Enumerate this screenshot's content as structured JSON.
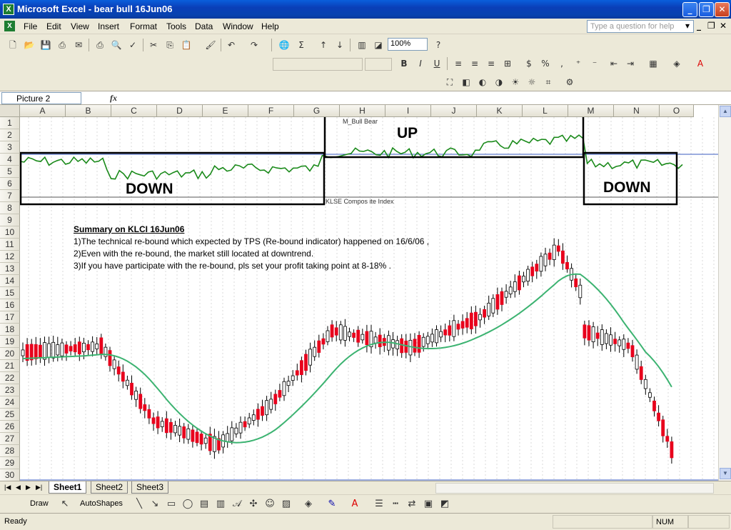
{
  "window": {
    "title": "Microsoft Excel - bear bull 16Jun06",
    "app_icon_glyph": "X"
  },
  "menu": {
    "items": [
      "File",
      "Edit",
      "View",
      "Insert",
      "Format",
      "Tools",
      "Data",
      "Window",
      "Help"
    ],
    "help_placeholder": "Type a question for help"
  },
  "toolbar": {
    "zoom": "100%"
  },
  "formula_bar": {
    "name_box": "Picture 2",
    "fx": "fx"
  },
  "columns": [
    "A",
    "B",
    "C",
    "D",
    "E",
    "F",
    "G",
    "H",
    "I",
    "J",
    "K",
    "L",
    "M",
    "N",
    "O"
  ],
  "rows": [
    "1",
    "2",
    "3",
    "4",
    "5",
    "6",
    "7",
    "8",
    "9",
    "10",
    "11",
    "12",
    "13",
    "14",
    "15",
    "16",
    "17",
    "18",
    "19",
    "20",
    "21",
    "22",
    "23",
    "24",
    "25",
    "26",
    "27",
    "28",
    "29",
    "30"
  ],
  "chart": {
    "label_down_left": "DOWN",
    "label_up": "UP",
    "label_down_right": "DOWN",
    "indicator_name": "M_Bull Bear",
    "index_name": "KLSE Compos ite Index",
    "colors": {
      "indicator": "#1a8a1a",
      "candle_up": "#ffffff",
      "candle_down": "#e8001c",
      "moving_average": "#3cb371",
      "frame": "#000000"
    }
  },
  "summary": {
    "title": "Summary on KLCI 16Jun06",
    "line1": "1)The technical re-bound which expected by TPS (Re-bound indicator) happened on 16/6/06 ,",
    "line2": "2)Even with the re-bound, the market still located at downtrend.",
    "line3": "3)If you have participate with the re-bound, pls set your profit taking point at 8-18% ."
  },
  "sheets": [
    "Sheet1",
    "Sheet2",
    "Sheet3"
  ],
  "drawbar": {
    "draw_label": "Draw",
    "autoshapes_label": "AutoShapes"
  },
  "status": {
    "ready": "Ready",
    "num": "NUM"
  }
}
